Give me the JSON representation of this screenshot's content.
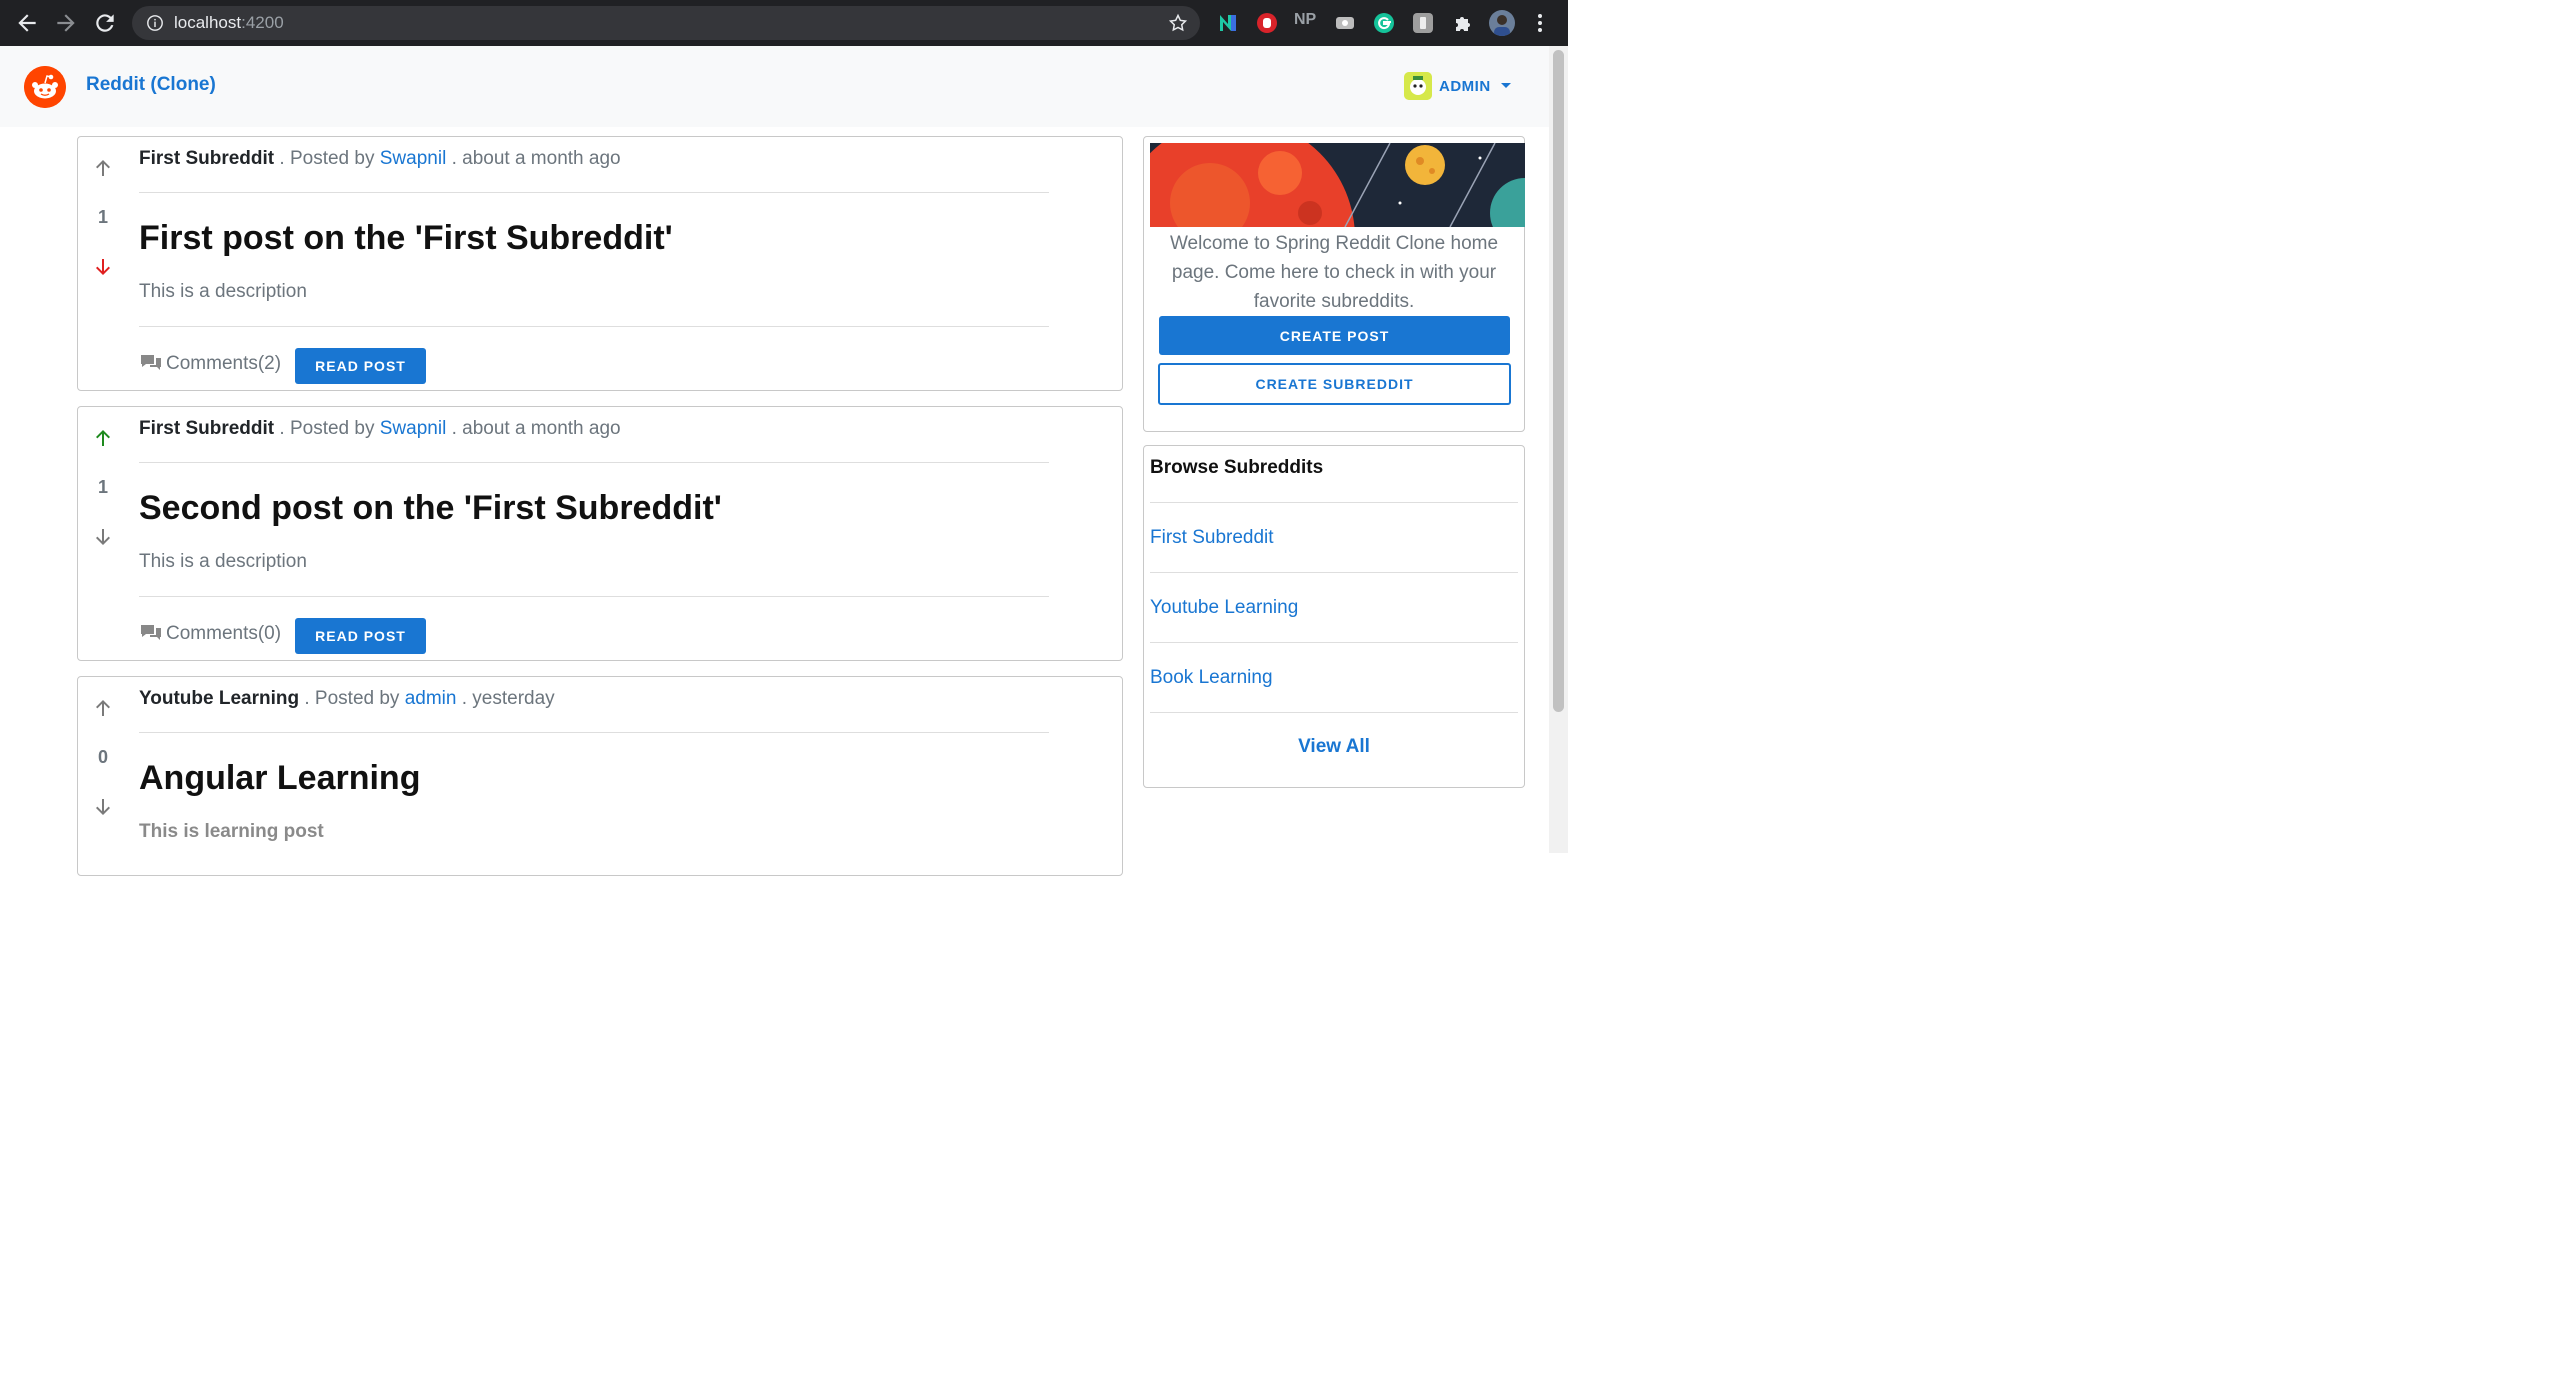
{
  "browser": {
    "url_host": "localhost",
    "url_port": ":4200",
    "extension_text": "NP"
  },
  "header": {
    "brand": "Reddit (Clone)",
    "user_menu_label": "ADMIN"
  },
  "posts": [
    {
      "subreddit": "First Subreddit",
      "posted_by_prefix": ". Posted by",
      "author": "Swapnil",
      "time": ". about a month ago",
      "votes": "1",
      "vote_state": "down",
      "title": "First post on the 'First Subreddit'",
      "description": "This is a description",
      "comments": "Comments(2)",
      "read_label": "READ POST"
    },
    {
      "subreddit": "First Subreddit",
      "posted_by_prefix": ". Posted by",
      "author": "Swapnil",
      "time": ". about a month ago",
      "votes": "1",
      "vote_state": "up",
      "title": "Second post on the 'First Subreddit'",
      "description": "This is a description",
      "comments": "Comments(0)",
      "read_label": "READ POST"
    },
    {
      "subreddit": "Youtube Learning",
      "posted_by_prefix": ". Posted by",
      "author": "admin",
      "time": ". yesterday",
      "votes": "0",
      "vote_state": "none",
      "title": "Angular Learning",
      "description": "This is learning post"
    }
  ],
  "sidebar": {
    "welcome": "Welcome to Spring Reddit Clone home page. Come here to check in with your favorite subreddits.",
    "create_post_label": "CREATE POST",
    "create_subreddit_label": "CREATE SUBREDDIT",
    "browse_title": "Browse Subreddits",
    "subreddits": [
      "First Subreddit",
      "Youtube Learning",
      "Book Learning"
    ],
    "view_all_label": "View All"
  },
  "colors": {
    "accent": "#1976d2",
    "upvote_active": "#1e8a1e",
    "downvote_active": "#e02020",
    "vote_inactive": "#7a7a7a",
    "reddit_orange": "#ff4500"
  },
  "icons": {
    "up": "arrow-up-icon",
    "down": "arrow-down-icon",
    "comments": "comments-icon"
  }
}
